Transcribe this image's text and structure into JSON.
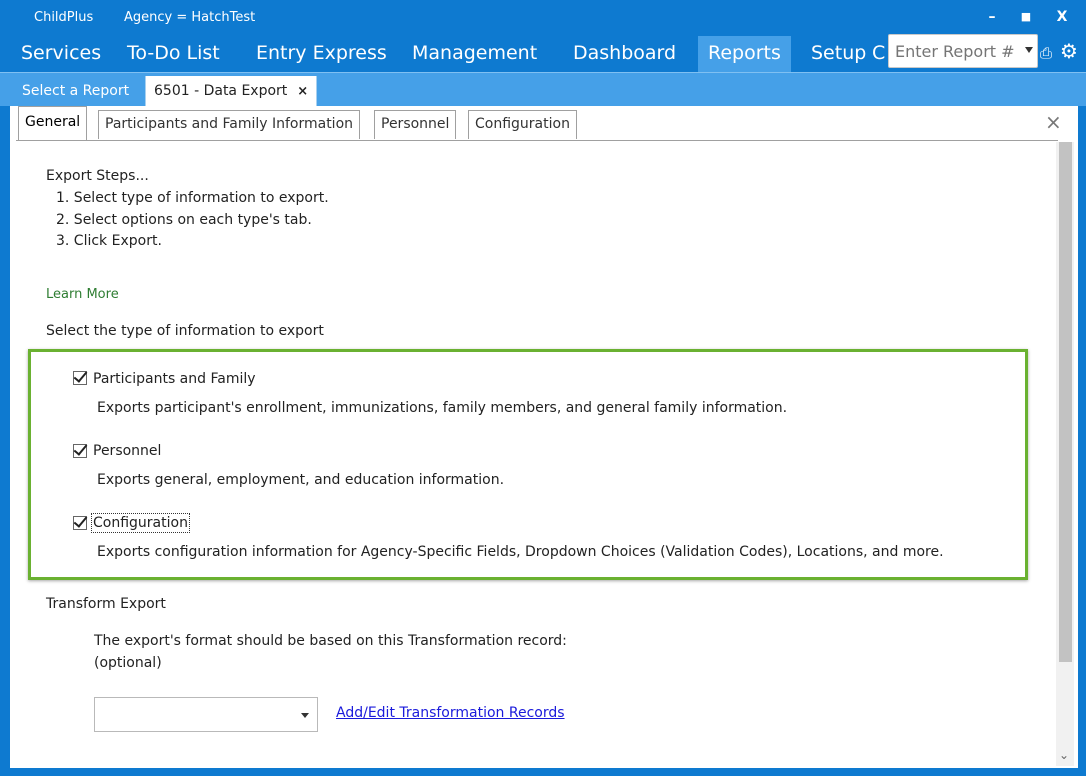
{
  "titlebar": {
    "app_name": "ChildPlus",
    "agency": "Agency = HatchTest",
    "minimize": "–",
    "maximize": "■",
    "close": "X"
  },
  "menu": {
    "items": [
      "Services",
      "To-Do List",
      "Entry Express",
      "Management",
      "Dashboard",
      "Reports",
      "Setup"
    ],
    "overflow_fragment": "C",
    "active": "Reports",
    "report_input_placeholder": "Enter Report #"
  },
  "doc_tabs": [
    {
      "label": "Select a Report"
    },
    {
      "label": "6501 - Data Export",
      "close": "×"
    }
  ],
  "sub_tabs": [
    "General",
    "Participants and Family Information",
    "Personnel",
    "Configuration"
  ],
  "panel_close": "×",
  "export_steps": {
    "heading": "Export Steps...",
    "steps": [
      "1.  Select type of information to export.",
      "2.  Select options on each type's tab.",
      "3.  Click Export."
    ]
  },
  "learn_more": "Learn More",
  "select_type_label": "Select the type of information to export",
  "options": [
    {
      "label": "Participants and Family",
      "checked": true,
      "description": "Exports participant's enrollment, immunizations, family members, and general family information."
    },
    {
      "label": "Personnel",
      "checked": true,
      "description": "Exports general, employment, and education information."
    },
    {
      "label": "Configuration",
      "checked": true,
      "description": "Exports configuration information for Agency-Specific Fields, Dropdown Choices (Validation Codes), Locations, and more."
    }
  ],
  "transform": {
    "heading": "Transform Export",
    "line1": "The export's format should be based on this Transformation record:",
    "line2": "(optional)",
    "select_value": "",
    "link": "Add/Edit Transformation Records"
  },
  "colors": {
    "titlebar": "#0e7ad0",
    "active_tab": "#45a0e8",
    "highlight_box": "#6ab131",
    "link": "#1a1adb",
    "learn_more": "#2e7d32"
  }
}
